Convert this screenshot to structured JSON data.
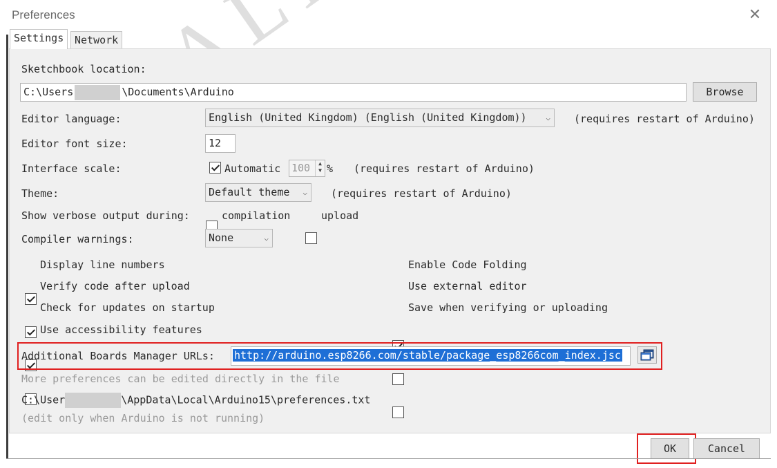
{
  "window": {
    "title": "Preferences",
    "close_glyph": "✕"
  },
  "tabs": [
    {
      "label": "Settings"
    },
    {
      "label": "Network"
    }
  ],
  "watermark": "ALL",
  "sketchbook": {
    "label": "Sketchbook location:",
    "path_prefix": "C:\\Users",
    "path_suffix": "\\Documents\\Arduino",
    "browse_label": "Browse"
  },
  "editor_language": {
    "label": "Editor language:",
    "value": "English (United Kingdom) (English (United Kingdom))",
    "note": "(requires restart of Arduino)"
  },
  "editor_font_size": {
    "label": "Editor font size:",
    "value": "12"
  },
  "interface_scale": {
    "label": "Interface scale:",
    "automatic_label": "Automatic",
    "automatic_checked": true,
    "value": "100",
    "unit": "%",
    "note": "(requires restart of Arduino)"
  },
  "theme": {
    "label": "Theme:",
    "value": "Default theme",
    "note": "(requires restart of Arduino)"
  },
  "verbose": {
    "label": "Show verbose output during:",
    "compilation_label": "compilation",
    "compilation_checked": false,
    "upload_label": "upload",
    "upload_checked": false
  },
  "compiler_warnings": {
    "label": "Compiler warnings:",
    "value": "None"
  },
  "options_left": [
    {
      "label": "Display line numbers",
      "checked": true
    },
    {
      "label": "Verify code after upload",
      "checked": true
    },
    {
      "label": "Check for updates on startup",
      "checked": true
    },
    {
      "label": "Use accessibility features",
      "checked": false
    }
  ],
  "options_right": [
    {
      "label": "Enable Code Folding",
      "checked": true
    },
    {
      "label": "Use external editor",
      "checked": false
    },
    {
      "label": "Save when verifying or uploading",
      "checked": false
    }
  ],
  "boards_urls": {
    "label": "Additional Boards Manager URLs:",
    "value": "http://arduino.esp8266.com/stable/package_esp8266com_index.jsc"
  },
  "more_prefs": {
    "note": "More preferences can be edited directly in the file",
    "path_prefix": "C:\\User",
    "path_suffix": "\\AppData\\Local\\Arduino15\\preferences.txt",
    "edit_note": "(edit only when Arduino is not running)"
  },
  "buttons": {
    "ok": "OK",
    "cancel": "Cancel"
  },
  "colors": {
    "highlight_red": "#e02020",
    "selection_blue": "#1e6fd6"
  }
}
